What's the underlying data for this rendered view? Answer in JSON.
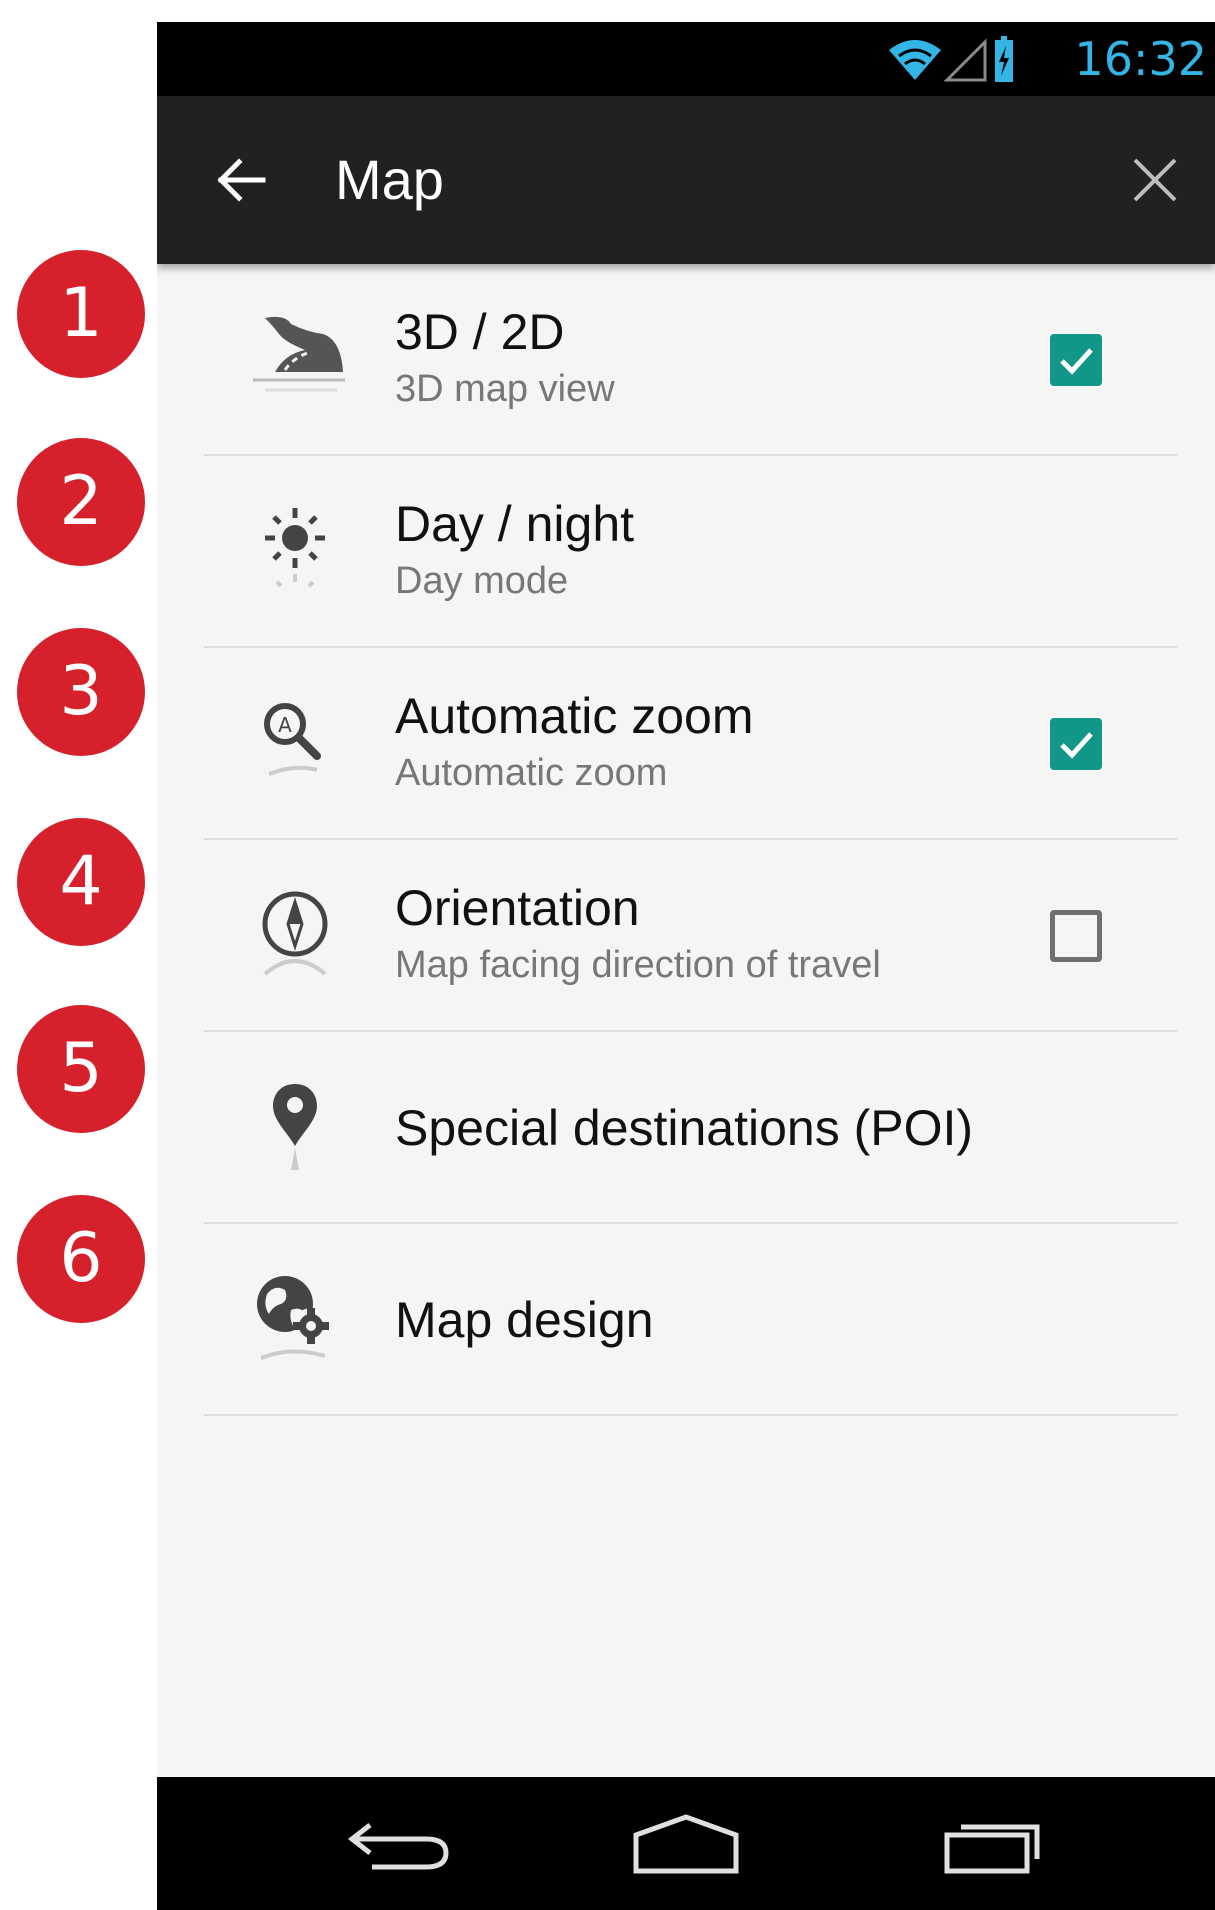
{
  "callouts": [
    "1",
    "2",
    "3",
    "4",
    "5",
    "6"
  ],
  "status_bar": {
    "time": "16:32",
    "icons": [
      "wifi-icon",
      "cell-signal-icon",
      "battery-charging-icon"
    ],
    "time_color": "#33b5e5"
  },
  "app_bar": {
    "title": "Map",
    "back_icon": "arrow-left-icon",
    "close_icon": "close-icon"
  },
  "settings": [
    {
      "title": "3D / 2D",
      "subtitle": "3D map view",
      "icon": "road-3d-icon",
      "checkbox": "checked"
    },
    {
      "title": "Day / night",
      "subtitle": "Day mode",
      "icon": "sun-icon",
      "checkbox": "none"
    },
    {
      "title": "Automatic zoom",
      "subtitle": "Automatic zoom",
      "icon": "zoom-auto-icon",
      "checkbox": "checked"
    },
    {
      "title": "Orientation",
      "subtitle": "Map facing direction of travel",
      "icon": "compass-icon",
      "checkbox": "unchecked"
    },
    {
      "title": "Special destinations (POI)",
      "subtitle": "",
      "icon": "map-pin-icon",
      "checkbox": "none"
    },
    {
      "title": "Map design",
      "subtitle": "",
      "icon": "globe-gear-icon",
      "checkbox": "none"
    }
  ],
  "nav_bar": {
    "buttons": [
      "back-nav-icon",
      "home-nav-icon",
      "recent-apps-icon"
    ]
  },
  "colors": {
    "callout": "#d6202c",
    "checkbox_accent": "#129688",
    "app_bar": "#212121",
    "list_background": "#f5f5f5"
  }
}
